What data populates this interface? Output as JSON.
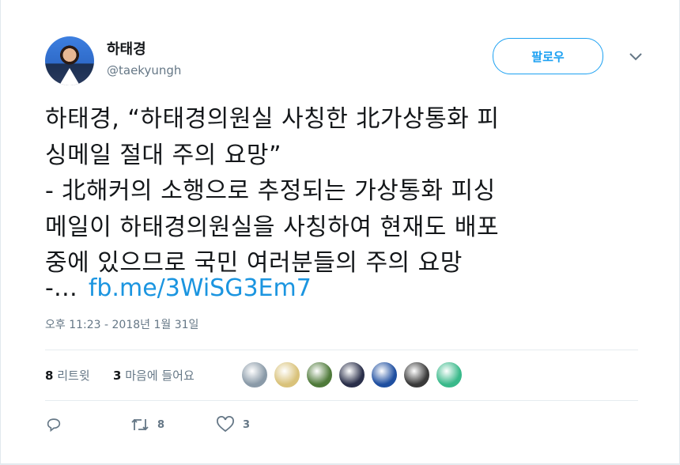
{
  "user": {
    "name": "하태경",
    "handle": "@taekyungh"
  },
  "follow_label": "팔로우",
  "tweet": {
    "lines": [
      "하태경, “하태경의원실 사칭한 北가상통화 피",
      "싱메일 절대 주의 요망”",
      "- 北해커의 소행으로 추정되는 가상통화 피싱",
      "메일이 하태경의원실을 사칭하여 현재도 배포",
      "중에 있으므로 국민 여러분들의 주의 요망"
    ],
    "ellipsis": "-…",
    "link": "fb.me/3WiSG3Em7"
  },
  "timestamp": "오후 11:23 - 2018년 1월 31일",
  "stats": {
    "retweet_count": "8",
    "retweet_label": "리트윗",
    "like_count": "3",
    "like_label": "마음에 들어요"
  },
  "liker_avatars": [
    "#8a9aa8",
    "#d9c27a",
    "#4f7a3a",
    "#2a2f4a",
    "#1f4fa0",
    "#3a3a3a",
    "#39b98a"
  ],
  "actions": {
    "retweets": "8",
    "likes": "3"
  },
  "colors": {
    "accent": "#1da1f2",
    "link": "#1b95e0",
    "muted": "#657786"
  }
}
